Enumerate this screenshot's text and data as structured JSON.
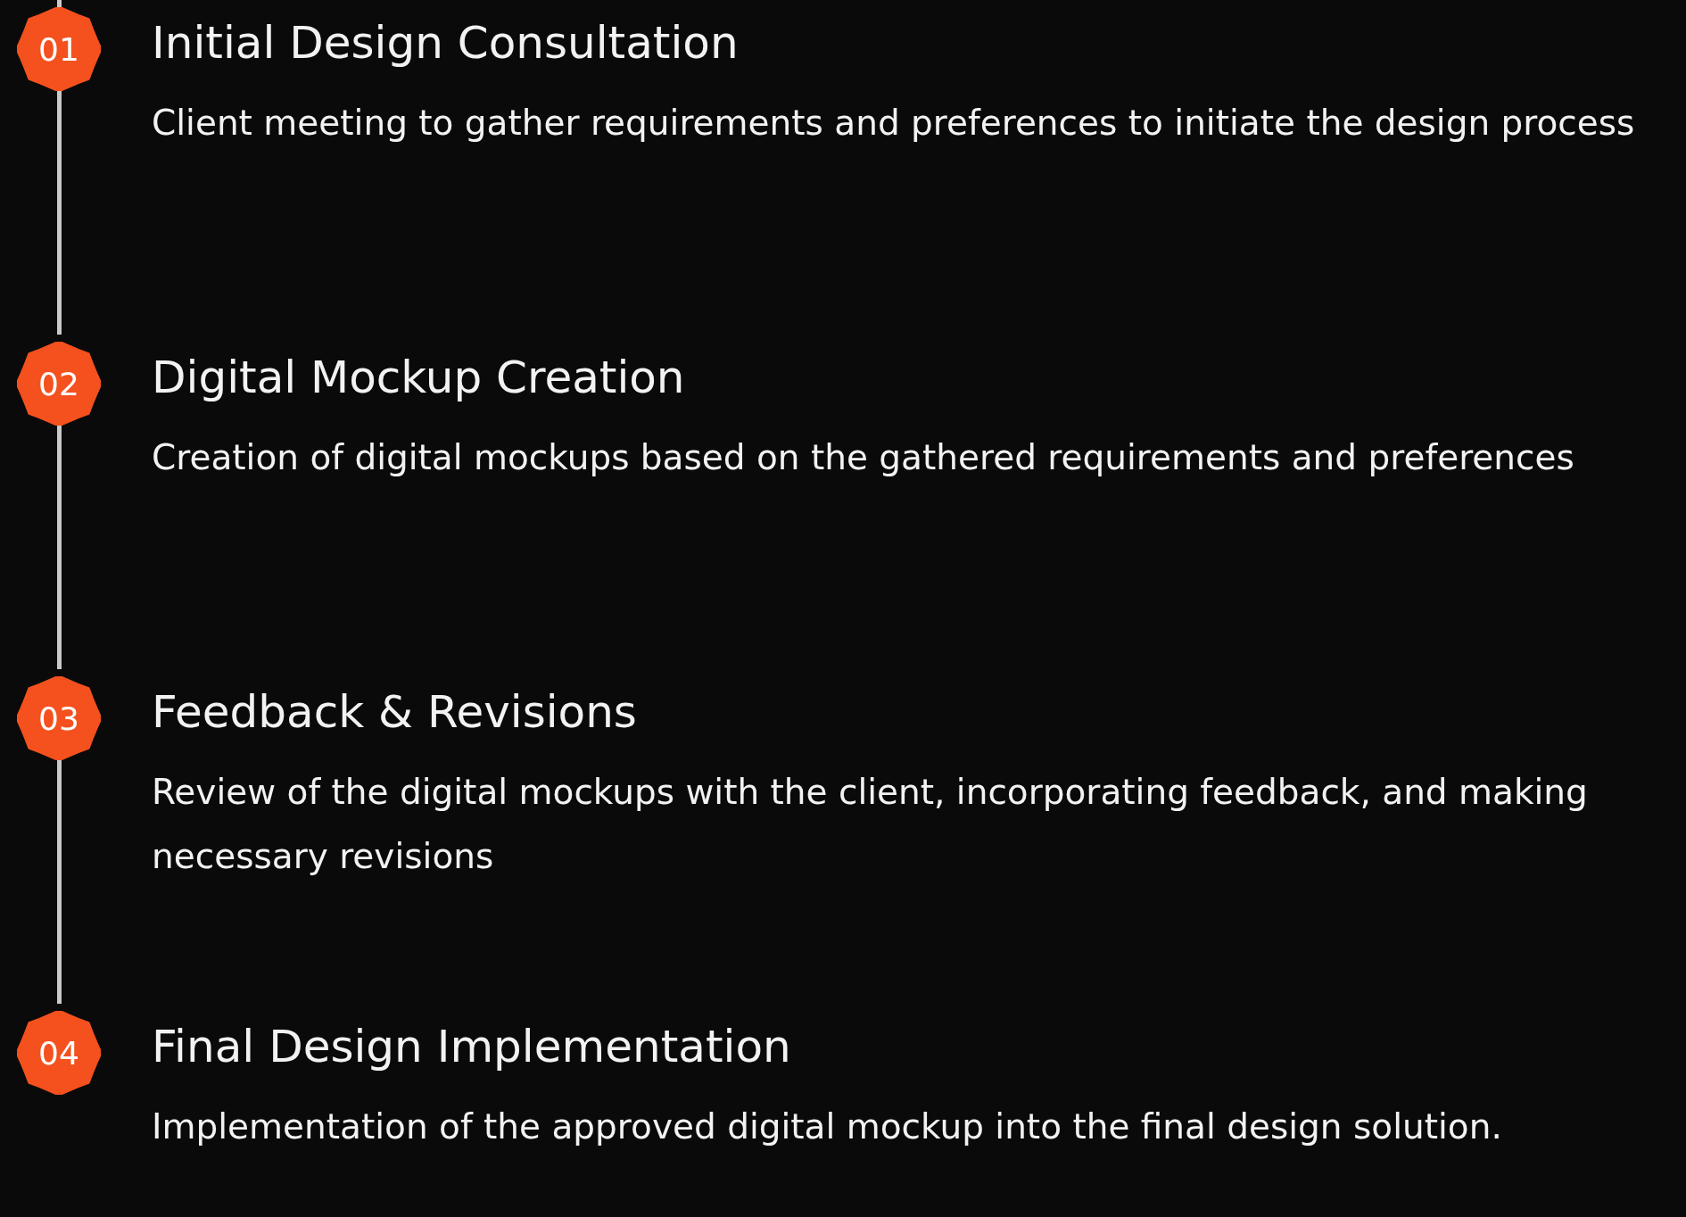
{
  "steps": [
    {
      "number": "01",
      "title": "Initial Design Consultation",
      "description": "Client meeting to gather requirements and preferences to initiate the design process"
    },
    {
      "number": "02",
      "title": "Digital Mockup Creation",
      "description": "Creation of digital mockups based on the gathered requirements and preferences"
    },
    {
      "number": "03",
      "title": "Feedback & Revisions",
      "description": "Review of the digital mockups with the client, incorporating feedback, and making necessary revisions"
    },
    {
      "number": "04",
      "title": "Final Design Implementation",
      "description": "Implementation of the approved digital mockup into the final design solution."
    }
  ]
}
